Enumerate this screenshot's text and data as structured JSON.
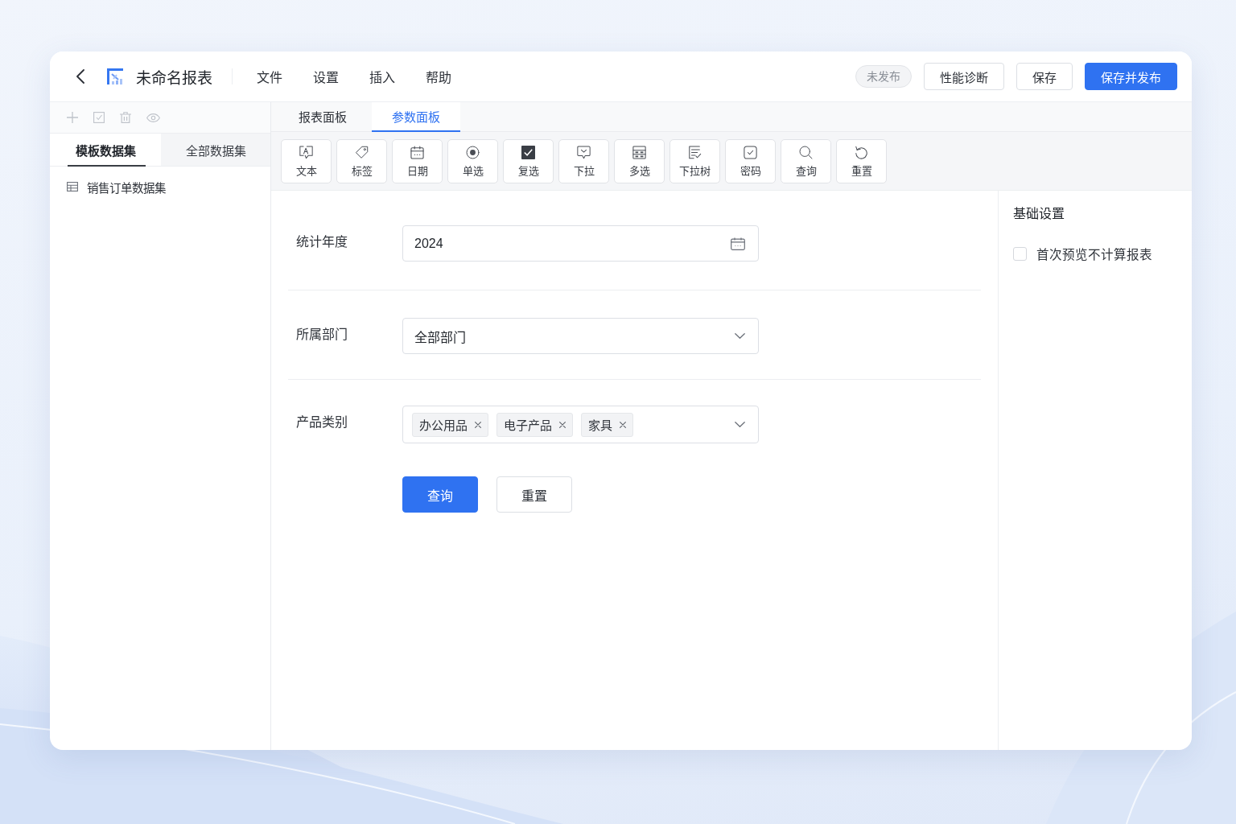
{
  "header": {
    "title": "未命名报表",
    "menu": [
      "文件",
      "设置",
      "插入",
      "帮助"
    ],
    "status": "未发布",
    "buttons": [
      {
        "label": "性能诊断",
        "kind": "default"
      },
      {
        "label": "保存",
        "kind": "default"
      },
      {
        "label": "保存并发布",
        "kind": "primary"
      }
    ]
  },
  "left_panel": {
    "toolbar": [
      {
        "disabled": true
      },
      {
        "disabled": true
      },
      {
        "disabled": true
      },
      {
        "disabled": true
      }
    ],
    "tabs": [
      {
        "label": "模板数据集",
        "selected": true
      },
      {
        "label": "全部数据集",
        "selected": false
      }
    ],
    "datasets": [
      "销售订单数据集"
    ]
  },
  "main": {
    "tabs": [
      {
        "label": "报表面板",
        "selected": false
      },
      {
        "label": "参数面板",
        "selected": true
      }
    ],
    "widgets": [
      "文本",
      "标签",
      "日期",
      "单选",
      "复选",
      "下拉",
      "多选",
      "下拉树",
      "密码",
      "查询",
      "重置"
    ],
    "fields": [
      {
        "label": "统计年度",
        "kind": "date",
        "value": "2024"
      },
      {
        "label": "所属部门",
        "kind": "select",
        "value": "全部部门"
      },
      {
        "label": "产品类别",
        "kind": "multiselect",
        "tags": [
          "办公用品",
          "电子产品",
          "家具"
        ]
      }
    ],
    "actions": [
      {
        "label": "查询",
        "kind": "primary"
      },
      {
        "label": "重置",
        "kind": "default"
      }
    ]
  },
  "settings_panel": {
    "title": "基础设置",
    "options": [
      {
        "label": "首次预览不计算报表",
        "checked": false
      }
    ]
  }
}
